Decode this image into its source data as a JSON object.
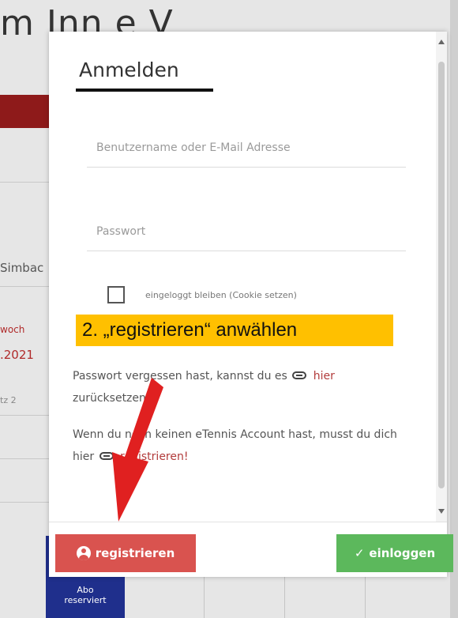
{
  "background": {
    "title": "m Inn e V",
    "side_texts": [
      "Simbac",
      "woch",
      ".2021",
      "tz 2"
    ],
    "abo_badge": [
      "Abo",
      "reserviert"
    ]
  },
  "modal": {
    "title": "Anmelden",
    "username_placeholder": "Benutzername oder E-Mail Adresse",
    "password_placeholder": "Passwort",
    "remember_label": "eingeloggt bleiben (Cookie setzen)",
    "forgot_text_1": "Passwort vergessen hast, kannst du es",
    "forgot_link": "hier",
    "forgot_text_2": "zurücksetzen.",
    "signup_text_1": "Wenn du noch keinen eTennis Account hast, musst du dich hier",
    "signup_link": "registrieren",
    "signup_text_2": "!",
    "register_button": "registrieren",
    "login_button": "einloggen"
  },
  "annotation": {
    "text": "2. „registrieren“ anwählen"
  },
  "colors": {
    "register": "#d9534f",
    "login": "#5cb85c",
    "annotation_bg": "#ffc000",
    "arrow": "#e02020",
    "abo": "#1f2f8c"
  },
  "icons": [
    "user-circle-icon",
    "checkmark-icon",
    "link-icon",
    "arrow-pointer"
  ]
}
